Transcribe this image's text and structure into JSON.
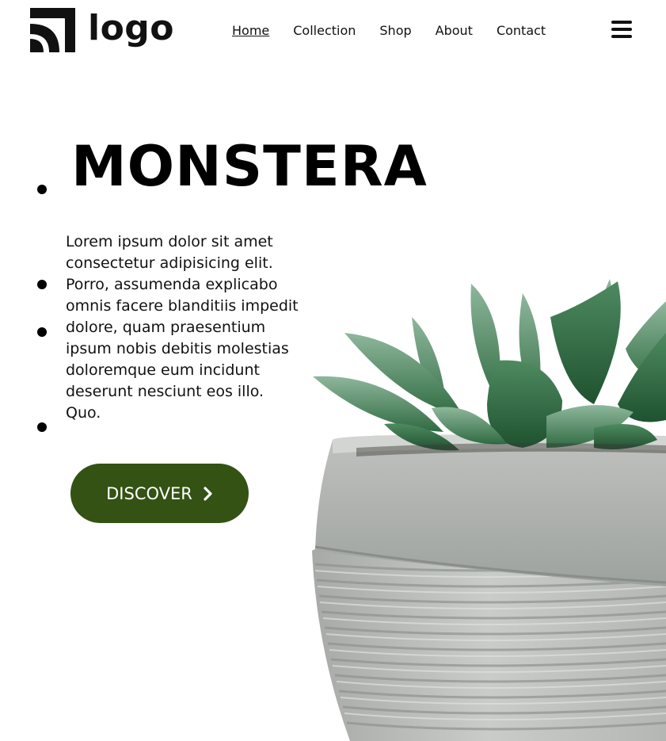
{
  "header": {
    "logo_text": "logo",
    "nav": [
      "Home",
      "Collection",
      "Shop",
      "About",
      "Contact"
    ],
    "active_nav": "Home",
    "menu_icon": "hamburger-icon"
  },
  "hero": {
    "title": "MONSTERA",
    "description": "Lorem ipsum dolor sit amet consectetur adipisicing elit. Porro, assumenda explicabo omnis facere blanditiis impedit dolore, quam praesentium ipsum nobis debitis molestias doloremque eum incidunt deserunt nesciunt eos illo. Quo.",
    "button_label": "DISCOVER",
    "button_icon": "chevron-right-icon",
    "button_color": "#345213"
  },
  "image": {
    "subject": "succulent-in-concrete-pot"
  }
}
